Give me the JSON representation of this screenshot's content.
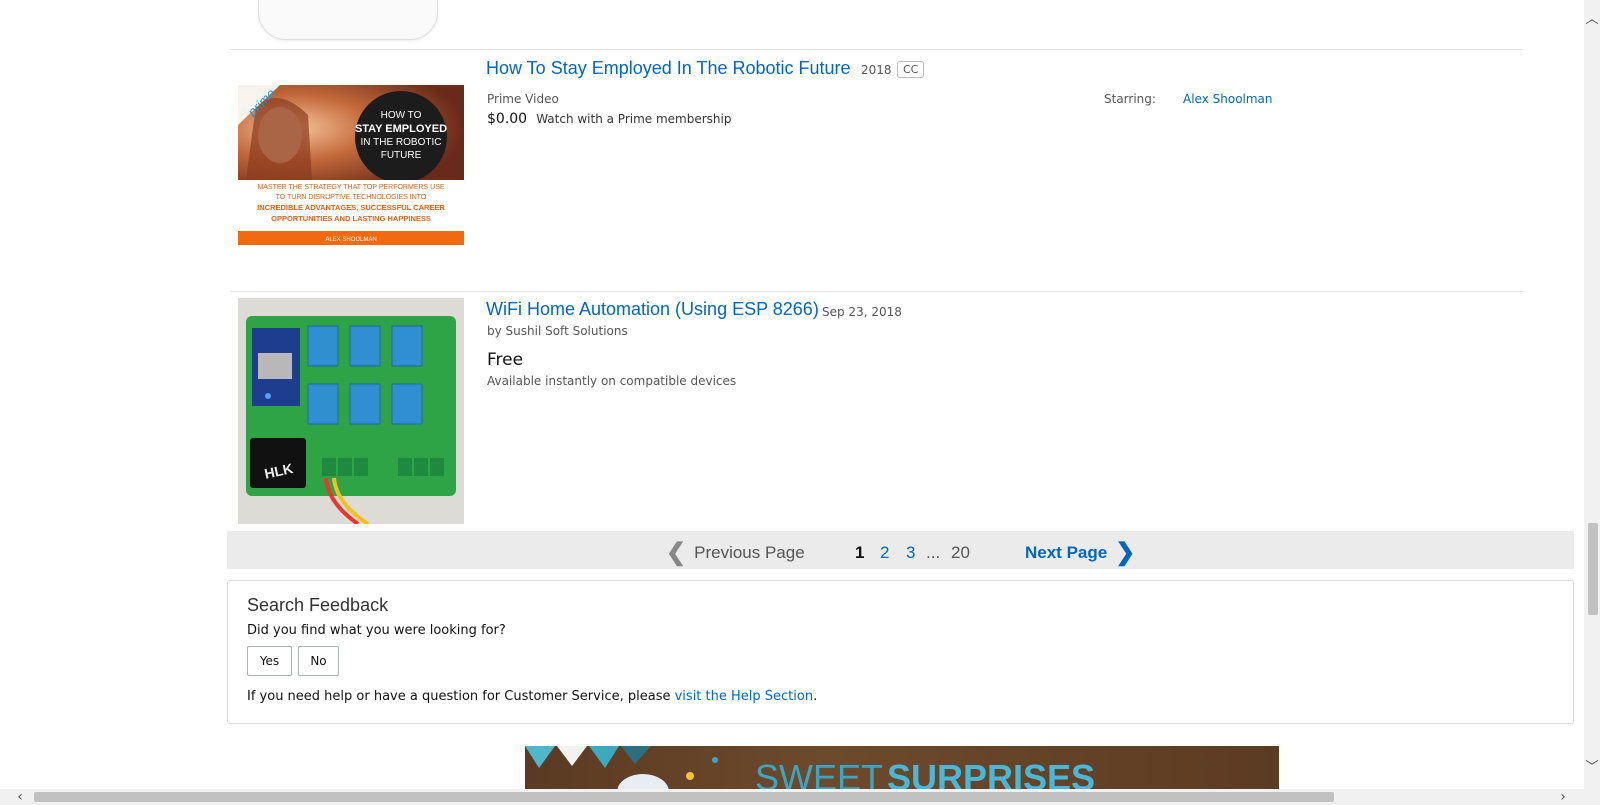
{
  "results": [
    {
      "title": "How To Stay Employed In The Robotic Future",
      "year": "2018",
      "cc_badge": "CC",
      "format": "Prime Video",
      "price": "$0.00",
      "price_note": "Watch with a Prime membership",
      "starring_label": "Starring:",
      "starring_name": "Alex Shoolman",
      "thumb": {
        "badge": "prime",
        "line1": "HOW TO",
        "line2": "STAY EMPLOYED",
        "line3": "IN THE ROBOTIC",
        "line4": "FUTURE",
        "tag1": "MASTER THE STRATEGY THAT TOP PERFORMERS USE",
        "tag2": "TO TURN DISRUPTIVE TECHNOLOGIES INTO",
        "tag3": "INCREDIBLE ADVANTAGES, SUCCESSFUL CAREER",
        "tag4": "OPPORTUNITIES AND LASTING HAPPINESS",
        "author": "ALEX SHOOLMAN"
      }
    },
    {
      "title": "WiFi Home Automation (Using ESP 8266)",
      "date": "Sep 23, 2018",
      "byline": "by Sushil Soft Solutions",
      "price": "Free",
      "availability": "Available instantly on compatible devices",
      "thumb": {
        "chip_label": "HLK"
      }
    }
  ],
  "pagination": {
    "previous": "Previous Page",
    "pages": [
      "1",
      "2",
      "3"
    ],
    "ellipsis": "...",
    "last": "20",
    "next": "Next Page",
    "prev_icon": "chevron-left-icon",
    "next_icon": "chevron-right-icon"
  },
  "feedback": {
    "title": "Search Feedback",
    "question": "Did you find what you were looking for?",
    "yes": "Yes",
    "no": "No",
    "help_prefix": "If you need help or have a question for Customer Service, please ",
    "help_link": "visit the Help Section",
    "help_suffix": "."
  },
  "banner": {
    "word1": "SWEET",
    "word2": "SURPRISES"
  },
  "colors": {
    "link": "#0066c0",
    "pager_bg": "#ebebeb",
    "thumb_orange": "#f26a10"
  }
}
